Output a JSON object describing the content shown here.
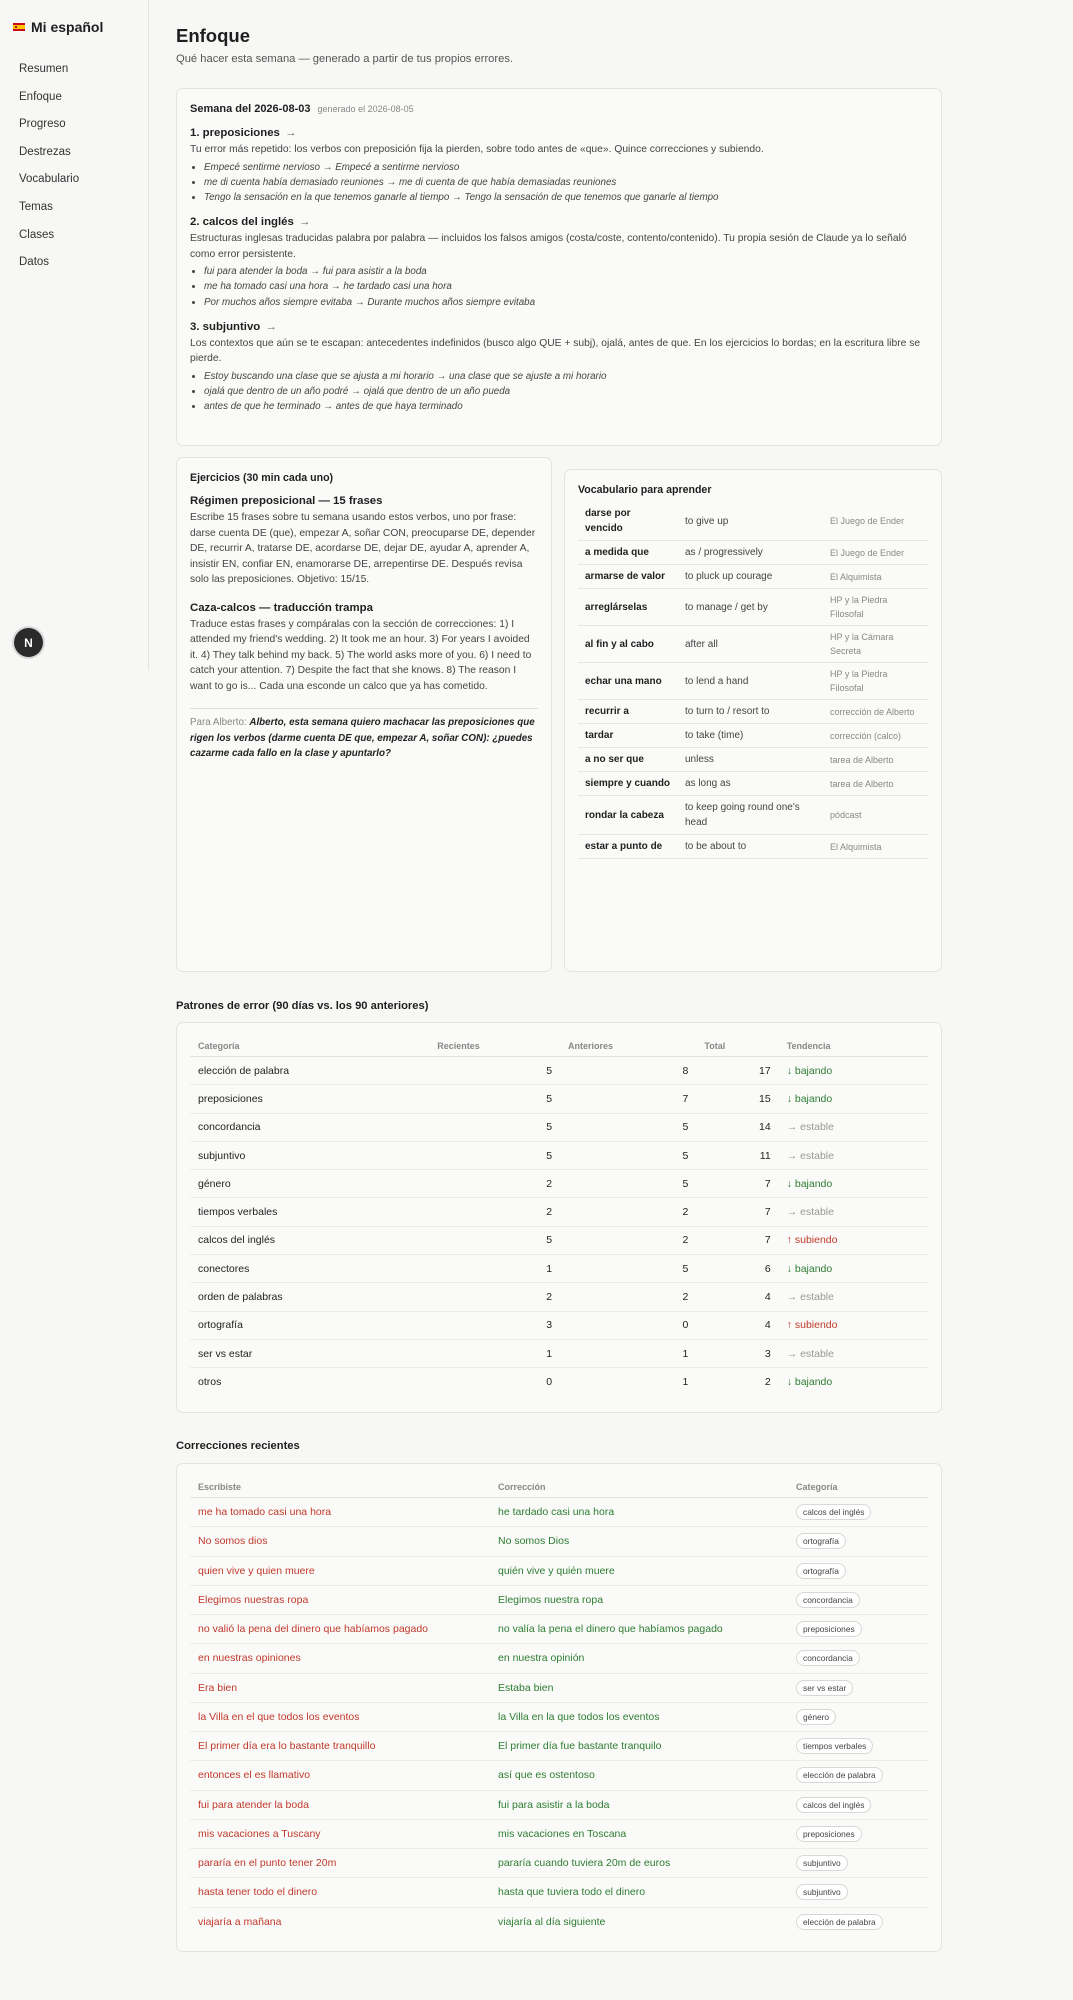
{
  "sidebar": {
    "brand": "Mi español",
    "items": [
      {
        "label": "Resumen"
      },
      {
        "label": "Enfoque"
      },
      {
        "label": "Progreso"
      },
      {
        "label": "Destrezas"
      },
      {
        "label": "Vocabulario"
      },
      {
        "label": "Temas"
      },
      {
        "label": "Clases"
      },
      {
        "label": "Datos"
      }
    ],
    "fab": "N"
  },
  "header": {
    "title": "Enfoque",
    "subtitle": "Qué hacer esta semana — generado a partir de tus propios errores."
  },
  "plan": {
    "week": "Semana del 2026-08-03",
    "generated": "generado el 2026-08-05",
    "issues": [
      {
        "title": "1. preposiciones",
        "arrow": "→",
        "text": "Tu error más repetido: los verbos con preposición fija la pierden, sobre todo antes de «que». Quince correcciones y subiendo.",
        "examples": [
          "Empecé sentirme nervioso → Empecé a sentirme nervioso",
          "me di cuenta había demasiado reuniones → me di cuenta de que había demasiadas reuniones",
          "Tengo la sensación en la que tenemos ganarle al tiempo → Tengo la sensación de que tenemos que ganarle al tiempo"
        ]
      },
      {
        "title": "2. calcos del inglés",
        "arrow": "→",
        "text": "Estructuras inglesas traducidas palabra por palabra — incluidos los falsos amigos (costa/coste, contento/contenido). Tu propia sesión de Claude ya lo señaló como error persistente.",
        "examples": [
          "fui para atender la boda → fui para asistir a la boda",
          "me ha tomado casi una hora → he tardado casi una hora",
          "Por muchos años siempre evitaba → Durante muchos años siempre evitaba"
        ]
      },
      {
        "title": "3. subjuntivo",
        "arrow": "→",
        "text": "Los contextos que aún se te escapan: antecedentes indefinidos (busco algo QUE + subj), ojalá, antes de que. En los ejercicios lo bordas; en la escritura libre se pierde.",
        "examples": [
          "Estoy buscando una clase que se ajusta a mi horario → una clase que se ajuste a mi horario",
          "ojalá que dentro de un año podré → ojalá que dentro de un año pueda",
          "antes de que he terminado → antes de que haya terminado"
        ]
      }
    ]
  },
  "exercises": {
    "title": "Ejercicios (30 min cada uno)",
    "items": [
      {
        "title": "Régimen preposicional — 15 frases",
        "text": "Escribe 15 frases sobre tu semana usando estos verbos, uno por frase: darse cuenta DE (que), empezar A, soñar CON, preocuparse DE, depender DE, recurrir A, tratarse DE, acordarse DE, dejar DE, ayudar A, aprender A, insistir EN, confiar EN, enamorarse DE, arrepentirse DE. Después revisa solo las preposiciones. Objetivo: 15/15."
      },
      {
        "title": "Caza-calcos — traducción trampa",
        "text": "Traduce estas frases y compáralas con la sección de correcciones: 1) I attended my friend's wedding. 2) It took me an hour. 3) For years I avoided it. 4) They talk behind my back. 5) The world asks more of you. 6) I need to catch your attention. 7) Despite the fact that she knows. 8) The reason I want to go is... Cada una esconde un calco que ya has cometido."
      }
    ],
    "note_label": "Para Alberto:",
    "note_text": "Alberto, esta semana quiero machacar las preposiciones que rigen los verbos (darme cuenta DE que, empezar A, soñar CON): ¿puedes cazarme cada fallo en la clase y apuntarlo?"
  },
  "vocab": {
    "title": "Vocabulario para aprender",
    "rows": [
      {
        "term": "darse por vencido",
        "meaning": "to give up",
        "source": "El Juego de Ender"
      },
      {
        "term": "a medida que",
        "meaning": "as / progressively",
        "source": "El Juego de Ender"
      },
      {
        "term": "armarse de valor",
        "meaning": "to pluck up courage",
        "source": "El Alquimista"
      },
      {
        "term": "arreglárselas",
        "meaning": "to manage / get by",
        "source": "HP y la Piedra Filosofal"
      },
      {
        "term": "al fin y al cabo",
        "meaning": "after all",
        "source": "HP y la Cámara Secreta"
      },
      {
        "term": "echar una mano",
        "meaning": "to lend a hand",
        "source": "HP y la Piedra Filosofal"
      },
      {
        "term": "recurrir a",
        "meaning": "to turn to / resort to",
        "source": "corrección de Alberto"
      },
      {
        "term": "tardar",
        "meaning": "to take (time)",
        "source": "corrección (calco)"
      },
      {
        "term": "a no ser que",
        "meaning": "unless",
        "source": "tarea de Alberto"
      },
      {
        "term": "siempre y cuando",
        "meaning": "as long as",
        "source": "tarea de Alberto"
      },
      {
        "term": "rondar la cabeza",
        "meaning": "to keep going round one's head",
        "source": "pódcast"
      },
      {
        "term": "estar a punto de",
        "meaning": "to be about to",
        "source": "El Alquimista"
      }
    ]
  },
  "patterns": {
    "title": "Patrones de error (90 días vs. los 90 anteriores)",
    "headers": {
      "category": "Categoría",
      "recent": "Recientes",
      "previous": "Anteriores",
      "total": "Total",
      "trend": "Tendencia"
    },
    "rows": [
      {
        "category": "elección de palabra",
        "recent": "5",
        "previous": "8",
        "total": "17",
        "trend": "↓ bajando",
        "dir": "down"
      },
      {
        "category": "preposiciones",
        "recent": "5",
        "previous": "7",
        "total": "15",
        "trend": "↓ bajando",
        "dir": "down"
      },
      {
        "category": "concordancia",
        "recent": "5",
        "previous": "5",
        "total": "14",
        "trend": "→ estable",
        "dir": "stable"
      },
      {
        "category": "subjuntivo",
        "recent": "5",
        "previous": "5",
        "total": "11",
        "trend": "→ estable",
        "dir": "stable"
      },
      {
        "category": "género",
        "recent": "2",
        "previous": "5",
        "total": "7",
        "trend": "↓ bajando",
        "dir": "down"
      },
      {
        "category": "tiempos verbales",
        "recent": "2",
        "previous": "2",
        "total": "7",
        "trend": "→ estable",
        "dir": "stable"
      },
      {
        "category": "calcos del inglés",
        "recent": "5",
        "previous": "2",
        "total": "7",
        "trend": "↑ subiendo",
        "dir": "up"
      },
      {
        "category": "conectores",
        "recent": "1",
        "previous": "5",
        "total": "6",
        "trend": "↓ bajando",
        "dir": "down"
      },
      {
        "category": "orden de palabras",
        "recent": "2",
        "previous": "2",
        "total": "4",
        "trend": "→ estable",
        "dir": "stable"
      },
      {
        "category": "ortografía",
        "recent": "3",
        "previous": "0",
        "total": "4",
        "trend": "↑ subiendo",
        "dir": "up"
      },
      {
        "category": "ser vs estar",
        "recent": "1",
        "previous": "1",
        "total": "3",
        "trend": "→ estable",
        "dir": "stable"
      },
      {
        "category": "otros",
        "recent": "0",
        "previous": "1",
        "total": "2",
        "trend": "↓ bajando",
        "dir": "down"
      }
    ],
    "colors": {
      "down": "#2e7d32",
      "up": "#c0392b",
      "stable": "#999999"
    }
  },
  "corrections": {
    "title": "Correcciones recientes",
    "headers": {
      "wrote": "Escribiste",
      "fixed": "Corrección",
      "category": "Categoría"
    },
    "rows": [
      {
        "wrote": "me ha tomado casi una hora",
        "fixed": "he tardado casi una hora",
        "category": "calcos del inglés"
      },
      {
        "wrote": "No somos dios",
        "fixed": "No somos Dios",
        "category": "ortografía"
      },
      {
        "wrote": "quien vive y quien muere",
        "fixed": "quién vive y quién muere",
        "category": "ortografía"
      },
      {
        "wrote": "Elegimos nuestras ropa",
        "fixed": "Elegimos nuestra ropa",
        "category": "concordancia"
      },
      {
        "wrote": "no valió la pena del dinero que habíamos pagado",
        "fixed": "no valía la pena el dinero que habíamos pagado",
        "category": "preposiciones"
      },
      {
        "wrote": "en nuestras opiniones",
        "fixed": "en nuestra opinión",
        "category": "concordancia"
      },
      {
        "wrote": "Era bien",
        "fixed": "Estaba bien",
        "category": "ser vs estar"
      },
      {
        "wrote": "la Villa en el que todos los eventos",
        "fixed": "la Villa en la que todos los eventos",
        "category": "género"
      },
      {
        "wrote": "El primer día era lo bastante tranquillo",
        "fixed": "El primer día fue bastante tranquilo",
        "category": "tiempos verbales"
      },
      {
        "wrote": "entonces el es llamativo",
        "fixed": "así que es ostentoso",
        "category": "elección de palabra"
      },
      {
        "wrote": "fui para atender la boda",
        "fixed": "fui para asistir a la boda",
        "category": "calcos del inglés"
      },
      {
        "wrote": "mis vacaciones a Tuscany",
        "fixed": "mis vacaciones en Toscana",
        "category": "preposiciones"
      },
      {
        "wrote": "pararía en el punto tener 20m",
        "fixed": "pararía cuando tuviera 20m de euros",
        "category": "subjuntivo"
      },
      {
        "wrote": "hasta tener todo el dinero",
        "fixed": "hasta que tuviera todo el dinero",
        "category": "subjuntivo"
      },
      {
        "wrote": "viajaría a mañana",
        "fixed": "viajaría al día siguiente",
        "category": "elección de palabra"
      }
    ]
  }
}
